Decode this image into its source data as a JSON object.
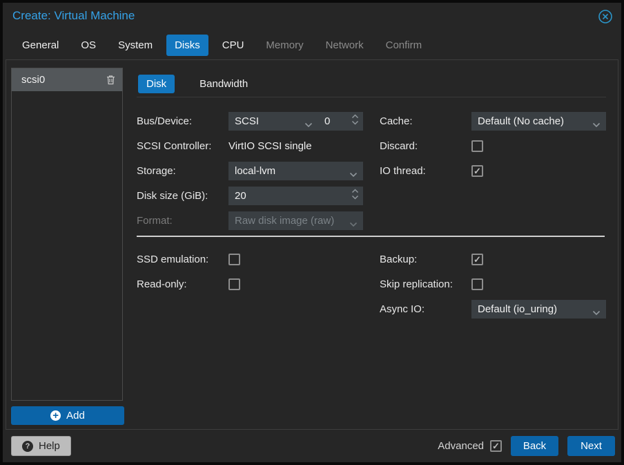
{
  "window": {
    "title": "Create: Virtual Machine",
    "close_icon": "circle-x-icon"
  },
  "tabs": [
    {
      "label": "General",
      "state": "enabled"
    },
    {
      "label": "OS",
      "state": "enabled"
    },
    {
      "label": "System",
      "state": "enabled"
    },
    {
      "label": "Disks",
      "state": "active"
    },
    {
      "label": "CPU",
      "state": "enabled"
    },
    {
      "label": "Memory",
      "state": "disabled"
    },
    {
      "label": "Network",
      "state": "disabled"
    },
    {
      "label": "Confirm",
      "state": "disabled"
    }
  ],
  "disk_list": {
    "items": [
      {
        "label": "scsi0",
        "selected": true,
        "delete_icon": "trash-icon"
      }
    ],
    "add_label": "Add",
    "add_icon": "plus-circle-icon"
  },
  "subtabs": [
    {
      "label": "Disk",
      "active": true
    },
    {
      "label": "Bandwidth",
      "active": false
    }
  ],
  "form": {
    "bus_device": {
      "label": "Bus/Device:",
      "value": "SCSI",
      "number": "0"
    },
    "scsi_controller": {
      "label": "SCSI Controller:",
      "value": "VirtIO SCSI single"
    },
    "storage": {
      "label": "Storage:",
      "value": "local-lvm"
    },
    "disk_size": {
      "label": "Disk size (GiB):",
      "value": "20"
    },
    "format": {
      "label": "Format:",
      "value": "Raw disk image (raw)",
      "disabled": true
    },
    "cache": {
      "label": "Cache:",
      "value": "Default (No cache)"
    },
    "discard": {
      "label": "Discard:",
      "checked": false
    },
    "io_thread": {
      "label": "IO thread:",
      "checked": true
    },
    "ssd_emulation": {
      "label": "SSD emulation:",
      "checked": false
    },
    "read_only": {
      "label": "Read-only:",
      "checked": false
    },
    "backup": {
      "label": "Backup:",
      "checked": true
    },
    "skip_replication": {
      "label": "Skip replication:",
      "checked": false
    },
    "async_io": {
      "label": "Async IO:",
      "value": "Default (io_uring)"
    }
  },
  "footer": {
    "help_label": "Help",
    "help_icon": "question-circle-icon",
    "advanced_label": "Advanced",
    "advanced_checked": true,
    "back_label": "Back",
    "next_label": "Next"
  },
  "colors": {
    "accent_tab_blue": "#1377bf",
    "button_blue": "#0b64a8",
    "title_blue": "#35a2e8",
    "dialog_bg": "#262626",
    "field_bg": "#3a3f43"
  }
}
